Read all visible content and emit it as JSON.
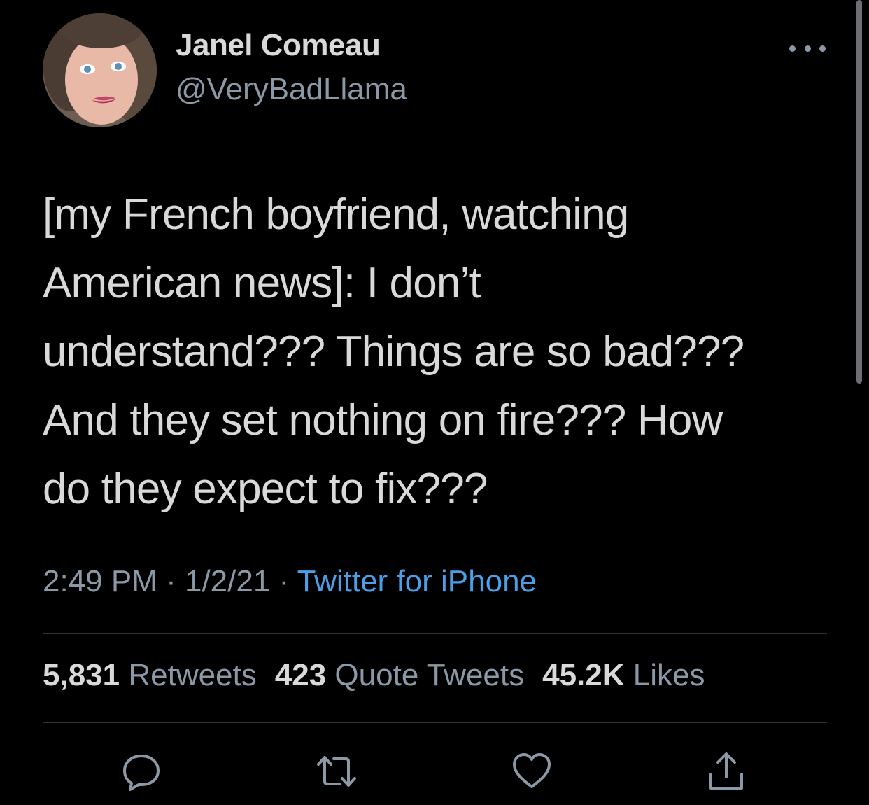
{
  "author": {
    "display_name": "Janel Comeau",
    "handle": "@VeryBadLlama"
  },
  "tweet": {
    "lines": [
      "[my French boyfriend, watching",
      "American news]: I don’t",
      "understand??? Things are so bad???",
      "And they set nothing on fire??? How",
      "do they expect to fix???"
    ],
    "time": "2:49 PM",
    "separator": " · ",
    "date": "1/2/21",
    "source": "Twitter for iPhone"
  },
  "stats": {
    "retweets_count": "5,831",
    "retweets_label": "Retweets",
    "quotes_count": "423",
    "quotes_label": "Quote Tweets",
    "likes_count": "45.2K",
    "likes_label": "Likes"
  },
  "icons": {
    "more": "more-icon",
    "reply": "reply-icon",
    "retweet": "retweet-icon",
    "like": "heart-icon",
    "share": "share-icon"
  },
  "colors": {
    "background": "#000000",
    "text": "#d9d9d9",
    "secondary": "#8b98a5",
    "link": "#4a9fe8",
    "divider": "#2f3336"
  }
}
